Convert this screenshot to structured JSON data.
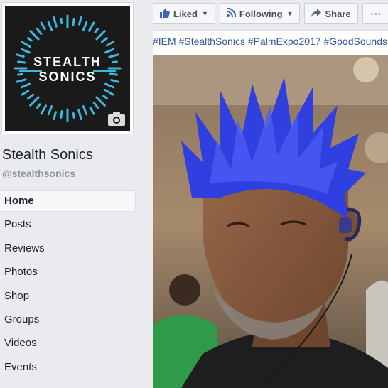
{
  "profile": {
    "logo_line1": "STEALTH",
    "logo_line2": "SONICS",
    "name": "Stealth Sonics",
    "handle": "@stealthsonics"
  },
  "nav": {
    "items": [
      {
        "label": "Home",
        "active": true
      },
      {
        "label": "Posts"
      },
      {
        "label": "Reviews"
      },
      {
        "label": "Photos"
      },
      {
        "label": "Shop"
      },
      {
        "label": "Groups"
      },
      {
        "label": "Videos"
      },
      {
        "label": "Events"
      }
    ]
  },
  "actions": {
    "liked_label": "Liked",
    "following_label": "Following",
    "share_label": "Share",
    "more_label": "···"
  },
  "post": {
    "hashtags": "#IEM #StealthSonics #PalmExpo2017 #GoodSounds"
  },
  "colors": {
    "link": "#365899",
    "logo_accent": "#3fb8e0",
    "hair_blue": "#2f3fe0"
  },
  "icons": {
    "liked": "thumbs-up-icon",
    "following": "rss-icon",
    "share": "share-arrow-icon",
    "more": "more-dots-icon",
    "camera": "camera-icon"
  }
}
